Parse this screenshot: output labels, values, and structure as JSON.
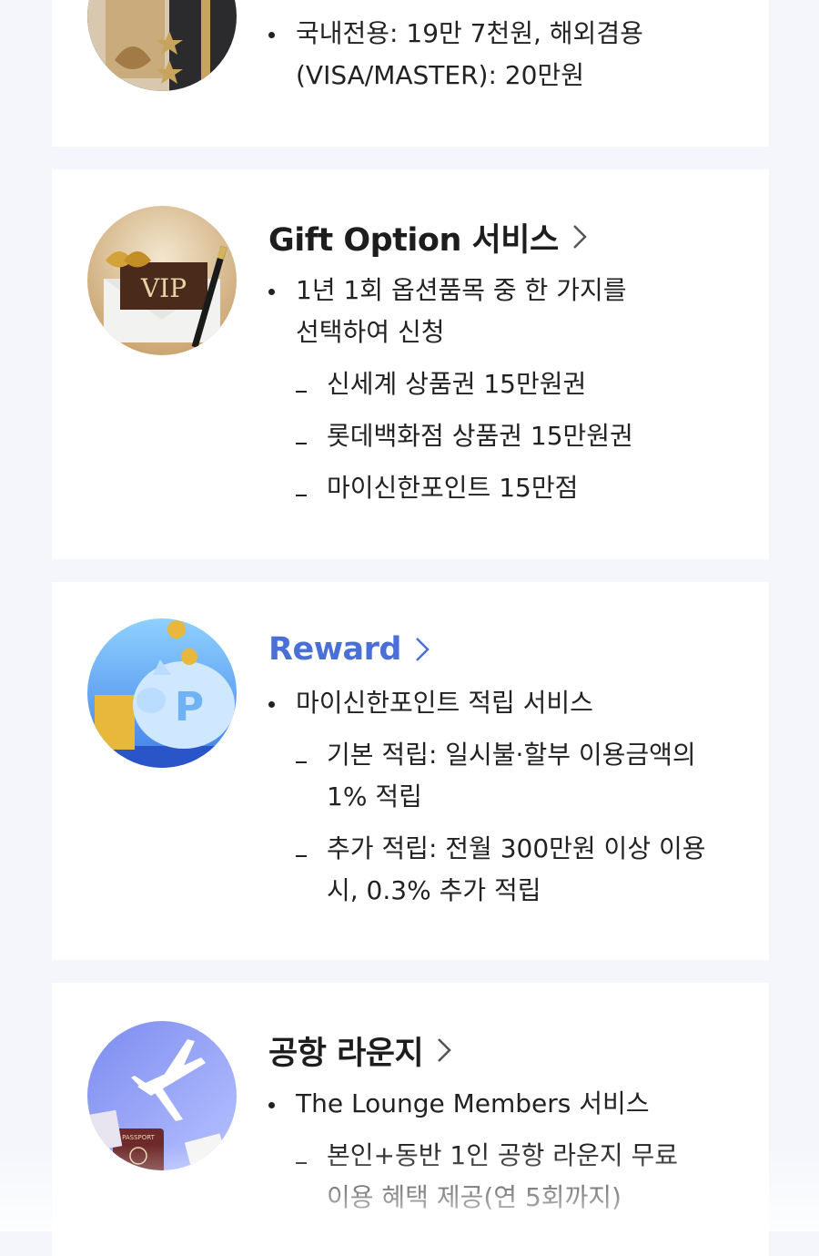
{
  "card_annual_fee": {
    "bullet_line1": "국내전용: 19만 7천원, 해외겸용",
    "bullet_line2": "(VISA/MASTER): 20만원"
  },
  "gift_option": {
    "title": "Gift Option 서비스",
    "bullet_line1": "1년 1회 옵션품목 중 한 가지를",
    "bullet_line2": "선택하여 신청",
    "items": [
      "신세계 상품권 15만원권",
      "롯데백화점 상품권 15만원권",
      "마이신한포인트 15만점"
    ],
    "image_text": "VIP"
  },
  "reward": {
    "title": "Reward",
    "title_color": "#4a6fd6",
    "bullet": "마이신한포인트 적립 서비스",
    "items": [
      {
        "line1": "기본 적립: 일시불·할부 이용금액의",
        "line2": "1% 적립"
      },
      {
        "line1": "추가 적립: 전월 300만원 이상 이용",
        "line2": "시, 0.3% 추가 적립"
      }
    ],
    "image_text": "P"
  },
  "lounge": {
    "title": "공항 라운지",
    "bullet": "The Lounge Members 서비스",
    "item_line1": "본인+동반 1인 공항 라운지 무료",
    "item_line2": "이용 혜택 제공(연 5회까지)",
    "image_text": "PASSPORT"
  }
}
